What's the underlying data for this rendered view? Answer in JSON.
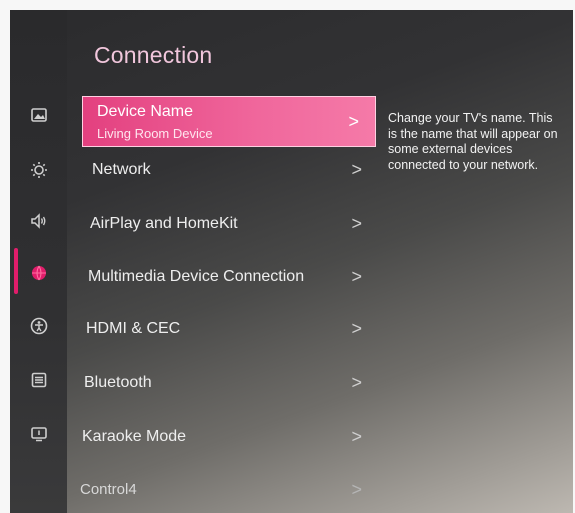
{
  "page": {
    "title": "Connection",
    "description": "Change your TV's name. This is the name that will appear on some external devices connected to your network."
  },
  "sidebar": {
    "icons": [
      {
        "name": "picture-icon",
        "active": false
      },
      {
        "name": "eco-icon",
        "active": false
      },
      {
        "name": "sound-icon",
        "active": false
      },
      {
        "name": "connection-icon",
        "active": true
      },
      {
        "name": "accessibility-icon",
        "active": false
      },
      {
        "name": "general-icon",
        "active": false
      },
      {
        "name": "support-icon",
        "active": false
      }
    ]
  },
  "menu": {
    "items": [
      {
        "label": "Device Name",
        "value": "Living Room Device",
        "chevron": ">",
        "selected": true
      },
      {
        "label": "Network",
        "chevron": ">"
      },
      {
        "label": "AirPlay and HomeKit",
        "chevron": ">"
      },
      {
        "label": "Multimedia Device Connection",
        "chevron": ">"
      },
      {
        "label": "HDMI & CEC",
        "chevron": ">"
      },
      {
        "label": "Bluetooth",
        "chevron": ">"
      },
      {
        "label": "Karaoke Mode",
        "chevron": ">"
      },
      {
        "label": "Control4",
        "chevron": ">"
      }
    ]
  },
  "colors": {
    "accent": "#e3407f",
    "active_indicator": "#e11d6b",
    "title": "#f1c6dc"
  }
}
